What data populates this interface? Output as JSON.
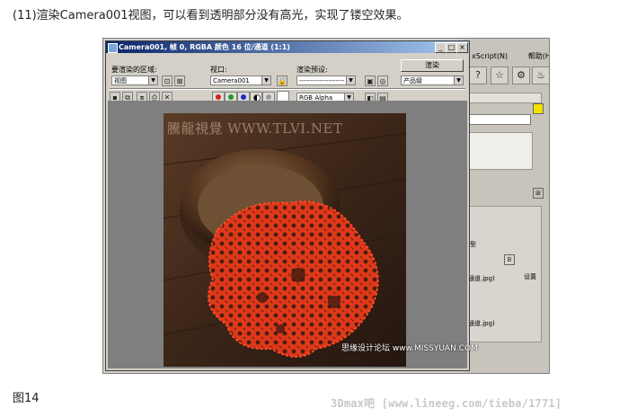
{
  "caption_top": "(11)渲染Camera001视图，可以看到透明部分没有高光，实现了镂空效果。",
  "caption_bottom": "图14",
  "footer_watermark": "3Dmax吧 [www.lineeg.com/tieba/1771]",
  "window": {
    "title": "Camera001, 帧 0, RGBA 颜色 16 位/通道 (1:1)",
    "title_buttons": [
      "_",
      "□",
      "×"
    ],
    "area_label": "要渲染的区域:",
    "area_value": "视图",
    "viewport_label": "视口:",
    "viewport_value": "Camera001",
    "preset_label": "渲染预设:",
    "preset_value": "--------------------",
    "render_button": "渲染",
    "product_value": "产品级",
    "channel_value": "RGB Alpha",
    "colors": {
      "red": "#d42020",
      "green": "#1d9a2a",
      "blue": "#1a2fc8",
      "titlebar_start": "#0a246a",
      "titlebar_end": "#a6caf0"
    }
  },
  "render_image": {
    "watermark_top": "騰龍視覺 WWW.TLVI.NET",
    "watermark_bottom": "思缘设计论坛 www.MISSYUAN.COM"
  },
  "background_panel": {
    "menu_items": [
      "xScript(N)",
      "帮助(H)"
    ],
    "list_labels": [
      "型",
      "通道.jpg)",
      "通道.jpg)"
    ],
    "setting_label": "设置",
    "square_label": "B"
  }
}
